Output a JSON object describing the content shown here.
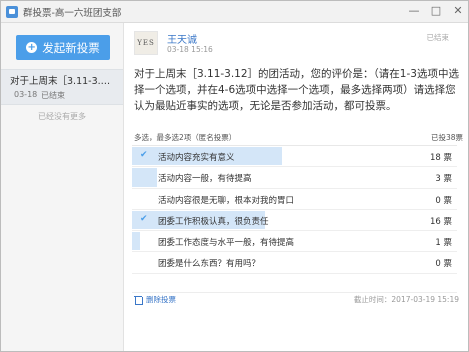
{
  "window": {
    "title": "群投票-高一六班团支部",
    "controls": {
      "minimize": "—",
      "maximize": "□",
      "close": "✕"
    }
  },
  "sidebar": {
    "new_vote_label": "发起新投票",
    "items": [
      {
        "title": "对于上周末［3.11-3.12］...",
        "date": "03-18",
        "status": "已结束"
      }
    ],
    "no_more_text": "已经没有更多"
  },
  "vote": {
    "author": "王天诚",
    "avatar_text": "YES",
    "time": "03-18 15:16",
    "status": "已结束",
    "question": "对于上周末［3.11-3.12］的团活动，您的评价是：（请在1-3选项中选择一个选项，并在4-6选项中选择一个选项，最多选择两项）请选择您认为最贴近事实的选项，无论是否参加活动，都可投票。",
    "meta": "多选，最多选2项（匿名投票）",
    "total": "已投38票",
    "options": [
      {
        "label": "活动内容充实有意义",
        "count": "18 票",
        "votes": 18,
        "checked": true
      },
      {
        "label": "活动内容一般，有待提高",
        "count": "3 票",
        "votes": 3,
        "checked": false
      },
      {
        "label": "活动内容很是无聊，根本对我的胃口",
        "count": "0 票",
        "votes": 0,
        "checked": false
      },
      {
        "label": "团委工作积极认真，很负责任",
        "count": "16 票",
        "votes": 16,
        "checked": true
      },
      {
        "label": "团委工作态度与水平一般，有待提高",
        "count": "1 票",
        "votes": 1,
        "checked": false
      },
      {
        "label": "团委是什么东西？有用吗？",
        "count": "0 票",
        "votes": 0,
        "checked": false
      }
    ],
    "delete_label": "删除投票",
    "deadline": "截止时间：2017-03-19 15:19"
  },
  "colors": {
    "accent": "#4b9ee9",
    "bar": "#d4e6f8",
    "link": "#3a77c8"
  }
}
